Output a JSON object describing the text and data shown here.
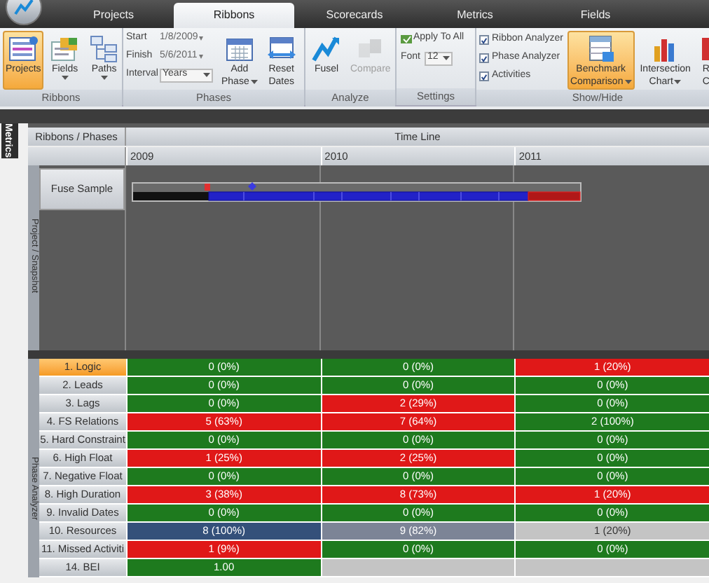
{
  "tabs": [
    {
      "label": "Projects",
      "selected": false
    },
    {
      "label": "Ribbons",
      "selected": true
    },
    {
      "label": "Scorecards",
      "selected": false
    },
    {
      "label": "Metrics",
      "selected": false
    },
    {
      "label": "Fields",
      "selected": false
    }
  ],
  "ribbon": {
    "ribbons": {
      "label": "Ribbons",
      "buttons": [
        {
          "kind": "projects",
          "lines": [
            "Projects"
          ],
          "selected": true,
          "dropdown": false
        },
        {
          "kind": "fields",
          "lines": [
            "Fields"
          ],
          "selected": false,
          "dropdown": true
        },
        {
          "kind": "paths",
          "lines": [
            "Paths"
          ],
          "selected": false,
          "dropdown": true
        }
      ]
    },
    "phases": {
      "label": "Phases",
      "start": {
        "label": "Start",
        "value": "1/8/2009"
      },
      "finish": {
        "label": "Finish",
        "value": "5/6/2011"
      },
      "interval": {
        "label": "Interval",
        "value": "Years"
      },
      "buttons": [
        {
          "kind": "calendar",
          "lines": [
            "Add",
            "Phase"
          ],
          "selected": false,
          "dropdown": true
        },
        {
          "kind": "reset",
          "lines": [
            "Reset",
            "Dates"
          ],
          "selected": false,
          "dropdown": false
        }
      ]
    },
    "analyze": {
      "label": "Analyze",
      "buttons": [
        {
          "kind": "fusel",
          "lines": [
            "Fusel"
          ],
          "disabled": false
        },
        {
          "kind": "compare",
          "lines": [
            "Compare"
          ],
          "disabled": true
        }
      ]
    },
    "settings": {
      "label": "Settings",
      "apply": "Apply To All",
      "font": {
        "label": "Font",
        "value": "12"
      }
    },
    "show_hide": {
      "label": "Show/Hide",
      "checkboxes": [
        {
          "label": "Ribbon Analyzer",
          "checked": true
        },
        {
          "label": "Phase Analyzer",
          "checked": true
        },
        {
          "label": "Activities",
          "checked": true
        }
      ],
      "buttons": [
        {
          "kind": "benchmark",
          "lines": [
            "Benchmark",
            "Comparison"
          ],
          "selected": true,
          "dropdown": true
        },
        {
          "kind": "chart",
          "lines": [
            "Intersection",
            "Chart"
          ],
          "selected": false,
          "dropdown": true
        },
        {
          "kind": "report",
          "lines": [
            "R",
            "C"
          ],
          "selected": false,
          "dropdown": false
        }
      ]
    }
  },
  "side_tab": "Metrics",
  "grid": {
    "corner": "Ribbons / Phases",
    "timeline": "Time Line",
    "years": [
      "2009",
      "2010",
      "2011"
    ],
    "project_label": "Project / Snapshot",
    "projects": [
      {
        "name": "Fuse Sample"
      }
    ],
    "phase_label": "Phase Analyzer",
    "rows": [
      {
        "label": "1. Logic",
        "selected": true,
        "cells": [
          {
            "text": "0 (0%)",
            "color": "#1e7a1e"
          },
          {
            "text": "0 (0%)",
            "color": "#1e7a1e"
          },
          {
            "text": "1 (20%)",
            "color": "#e01818"
          }
        ]
      },
      {
        "label": "2. Leads",
        "selected": false,
        "cells": [
          {
            "text": "0 (0%)",
            "color": "#1e7a1e"
          },
          {
            "text": "0 (0%)",
            "color": "#1e7a1e"
          },
          {
            "text": "0 (0%)",
            "color": "#1e7a1e"
          }
        ]
      },
      {
        "label": "3. Lags",
        "selected": false,
        "cells": [
          {
            "text": "0 (0%)",
            "color": "#1e7a1e"
          },
          {
            "text": "2 (29%)",
            "color": "#e01818"
          },
          {
            "text": "0 (0%)",
            "color": "#1e7a1e"
          }
        ]
      },
      {
        "label": "4. FS Relations",
        "selected": false,
        "cells": [
          {
            "text": "5 (63%)",
            "color": "#e01818"
          },
          {
            "text": "7 (64%)",
            "color": "#e01818"
          },
          {
            "text": "2 (100%)",
            "color": "#1e7a1e"
          }
        ]
      },
      {
        "label": "5. Hard Constraint",
        "selected": false,
        "cells": [
          {
            "text": "0 (0%)",
            "color": "#1e7a1e"
          },
          {
            "text": "0 (0%)",
            "color": "#1e7a1e"
          },
          {
            "text": "0 (0%)",
            "color": "#1e7a1e"
          }
        ]
      },
      {
        "label": "6. High Float",
        "selected": false,
        "cells": [
          {
            "text": "1 (25%)",
            "color": "#e01818"
          },
          {
            "text": "2 (25%)",
            "color": "#e01818"
          },
          {
            "text": "0 (0%)",
            "color": "#1e7a1e"
          }
        ]
      },
      {
        "label": "7. Negative Float",
        "selected": false,
        "cells": [
          {
            "text": "0 (0%)",
            "color": "#1e7a1e"
          },
          {
            "text": "0 (0%)",
            "color": "#1e7a1e"
          },
          {
            "text": "0 (0%)",
            "color": "#1e7a1e"
          }
        ]
      },
      {
        "label": "8. High Duration",
        "selected": false,
        "cells": [
          {
            "text": "3 (38%)",
            "color": "#e01818"
          },
          {
            "text": "8 (73%)",
            "color": "#e01818"
          },
          {
            "text": "1 (20%)",
            "color": "#e01818"
          }
        ]
      },
      {
        "label": "9. Invalid Dates",
        "selected": false,
        "cells": [
          {
            "text": "0 (0%)",
            "color": "#1e7a1e"
          },
          {
            "text": "0 (0%)",
            "color": "#1e7a1e"
          },
          {
            "text": "0 (0%)",
            "color": "#1e7a1e"
          }
        ]
      },
      {
        "label": "10. Resources",
        "selected": false,
        "cells": [
          {
            "text": "8 (100%)",
            "color": "#34507a"
          },
          {
            "text": "9 (82%)",
            "color": "#7c8496"
          },
          {
            "text": "1 (20%)",
            "color": "#c4c4c4"
          }
        ]
      },
      {
        "label": "11. Missed Activiti",
        "selected": false,
        "cells": [
          {
            "text": "1 (9%)",
            "color": "#e01818"
          },
          {
            "text": "0 (0%)",
            "color": "#1e7a1e"
          },
          {
            "text": "0 (0%)",
            "color": "#1e7a1e"
          }
        ]
      },
      {
        "label": "14. BEI",
        "selected": false,
        "cells": [
          {
            "text": "1.00",
            "color": "#1e7a1e"
          },
          {
            "color": "#c4c4c4"
          },
          {
            "color": "#c4c4c4"
          }
        ]
      }
    ]
  }
}
